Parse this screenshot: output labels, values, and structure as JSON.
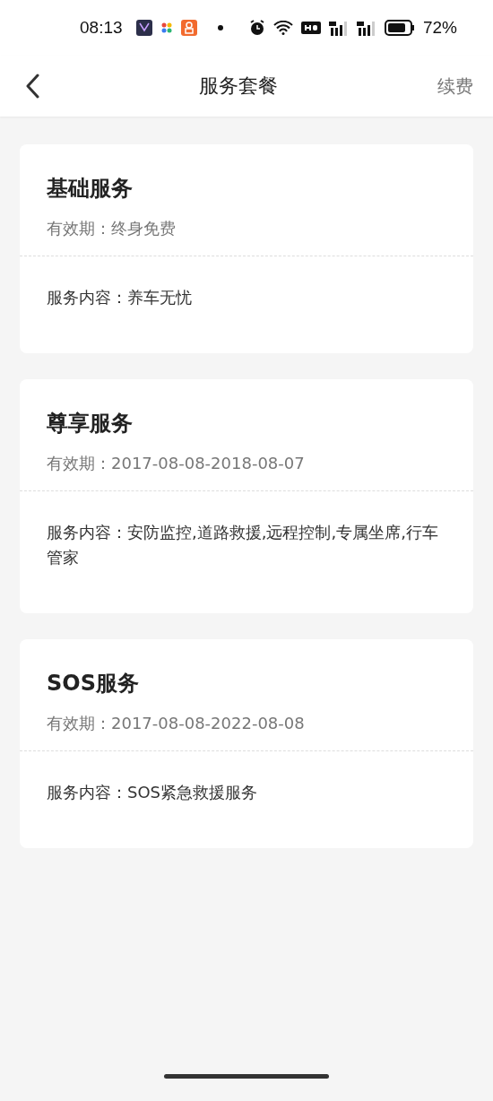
{
  "status_bar": {
    "time": "08:13",
    "battery_text": "72%"
  },
  "header": {
    "title": "服务套餐",
    "action": "续费"
  },
  "packages": [
    {
      "name": "基础服务",
      "validity": "有效期：终身免费",
      "content": "服务内容：养车无忧"
    },
    {
      "name": "尊享服务",
      "validity": "有效期：2017-08-08-2018-08-07",
      "content": "服务内容：安防监控,道路救援,远程控制,专属坐席,行车管家"
    },
    {
      "name": "SOS服务",
      "validity": "有效期：2017-08-08-2022-08-08",
      "content": "服务内容：SOS紧急救援服务"
    }
  ]
}
